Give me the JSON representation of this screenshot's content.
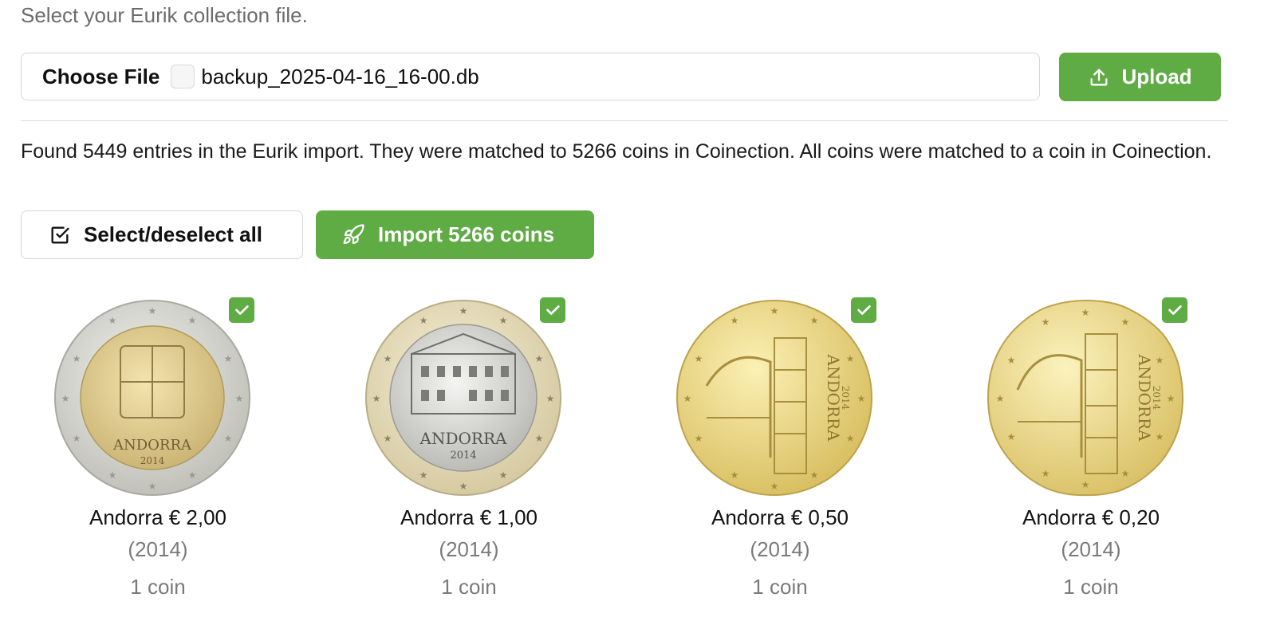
{
  "upload_section": {
    "hint": "Select your Eurik collection file.",
    "choose_label": "Choose File",
    "file_name": "backup_2025-04-16_16-00.db",
    "upload_label": "Upload",
    "upload_icon": "upload-icon"
  },
  "summary": "Found 5449 entries in the Eurik import. They were matched to 5266 coins in Coinection. All coins were matched to a coin in Coinection.",
  "actions": {
    "select_all_label": "Select/deselect all",
    "select_all_icon": "checkbox-icon",
    "import_label": "Import 5266 coins",
    "import_icon": "rocket-icon"
  },
  "colors": {
    "accent": "#5fab44",
    "muted_text": "#7a7a7a"
  },
  "coins": [
    {
      "title": "Andorra € 2,00",
      "year": "(2014)",
      "count": "1 coin",
      "selected": true,
      "coin_type": "bimetal-2euro",
      "coin_text": "ANDORRA",
      "coin_year": "2014"
    },
    {
      "title": "Andorra € 1,00",
      "year": "(2014)",
      "count": "1 coin",
      "selected": true,
      "coin_type": "bimetal-1euro",
      "coin_text": "ANDORRA",
      "coin_year": "2014"
    },
    {
      "title": "Andorra € 0,50",
      "year": "(2014)",
      "count": "1 coin",
      "selected": true,
      "coin_type": "gold-50cent",
      "coin_text": "ANDORRA",
      "coin_year": "2014"
    },
    {
      "title": "Andorra € 0,20",
      "year": "(2014)",
      "count": "1 coin",
      "selected": true,
      "coin_type": "gold-20cent",
      "coin_text": "ANDORRA",
      "coin_year": "2014"
    }
  ]
}
